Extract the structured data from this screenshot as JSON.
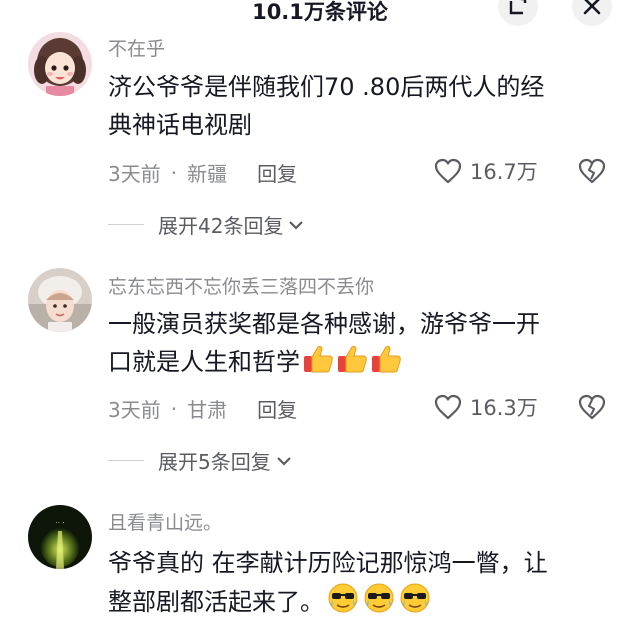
{
  "header": {
    "title": "10.1万条评论"
  },
  "comments": [
    {
      "username": "不在乎",
      "text_line1": "济公爷爷是伴随我们70 .80后两代人的经",
      "text_line2": "典神话电视剧",
      "time": "3天前",
      "location": "新疆",
      "reply_label": "回复",
      "likes": "16.7万",
      "expand_label": "展开42条回复"
    },
    {
      "username": "忘东忘西不忘你丢三落四不丢你",
      "text_line1": "一般演员获奖都是各种感谢，游爷爷一开",
      "text_line2": "口就是人生和哲学",
      "time": "3天前",
      "location": "甘肃",
      "reply_label": "回复",
      "likes": "16.3万",
      "expand_label": "展开5条回复"
    },
    {
      "username": "且看青山远。",
      "text_line1": "爷爷真的 在李献计历险记那惊鸿一瞥，让",
      "text_line2": "整部剧都活起来了。"
    }
  ],
  "dot": "·",
  "colors": {
    "text": "#161823",
    "secondary": "#8a8b91",
    "icon": "#5b5c63"
  }
}
